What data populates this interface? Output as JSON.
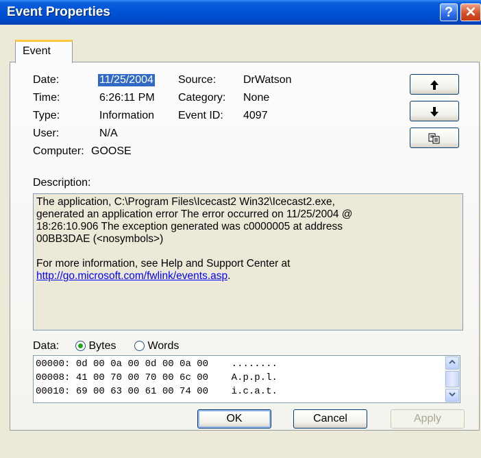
{
  "window": {
    "title": "Event Properties",
    "help_glyph": "?",
    "close_glyph": "✕"
  },
  "tabs": [
    {
      "label": "Event"
    }
  ],
  "fields": {
    "date_label": "Date:",
    "date_value": "11/25/2004",
    "time_label": "Time:",
    "time_value": "6:26:11 PM",
    "type_label": "Type:",
    "type_value": "Information",
    "user_label": "User:",
    "user_value": "N/A",
    "computer_label": "Computer:",
    "computer_value": "GOOSE",
    "source_label": "Source:",
    "source_value": "DrWatson",
    "category_label": "Category:",
    "category_value": "None",
    "eventid_label": "Event ID:",
    "eventid_value": "4097"
  },
  "side_buttons": {
    "up_icon": "🡅",
    "down_icon": "🡇",
    "copy_icon": "copy-icon"
  },
  "description": {
    "label": "Description:",
    "paragraph1_lines": [
      "The application, C:\\Program Files\\Icecast2 Win32\\Icecast2.exe,",
      "generated an application error The error occurred on 11/25/2004 @",
      "18:26:10.906 The exception generated was c0000005 at address",
      "00BB3DAE (<nosymbols>)"
    ],
    "paragraph2": "For more information, see Help and Support Center at",
    "link": "http://go.microsoft.com/fwlink/events.asp",
    "link_suffix": "."
  },
  "data": {
    "label": "Data:",
    "options": [
      {
        "label": "Bytes",
        "selected": true
      },
      {
        "label": "Words",
        "selected": false
      }
    ],
    "rows": [
      {
        "offset": "00000:",
        "hex": "0d 00 0a 00 0d 00 0a 00",
        "ascii": "........"
      },
      {
        "offset": "00008:",
        "hex": "41 00 70 00 70 00 6c 00",
        "ascii": "A.p.p.l."
      },
      {
        "offset": "00010:",
        "hex": "69 00 63 00 61 00 74 00",
        "ascii": "i.c.a.t."
      }
    ]
  },
  "buttons": {
    "ok": "OK",
    "cancel": "Cancel",
    "apply": "Apply",
    "apply_enabled": false
  },
  "colors": {
    "title_bar": "#0052d6",
    "selection": "#316ac5",
    "tab_highlight": "#ffc83c",
    "link": "#0000ff"
  }
}
